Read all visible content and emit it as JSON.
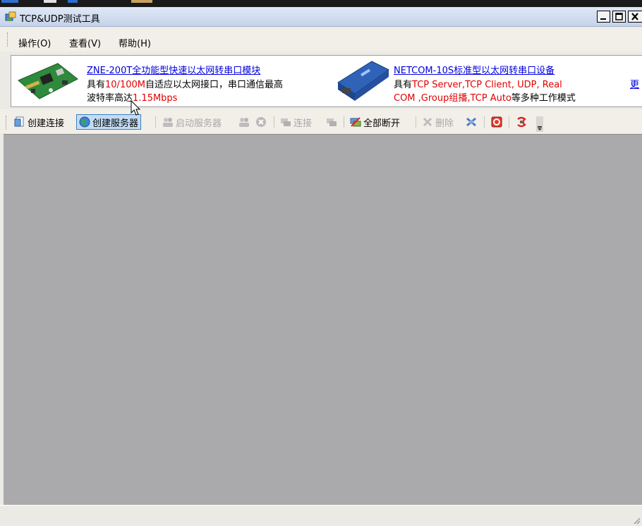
{
  "window": {
    "title": "TCP&UDP测试工具"
  },
  "menu": [
    {
      "label": "操作(O)"
    },
    {
      "label": "查看(V)"
    },
    {
      "label": "帮助(H)"
    }
  ],
  "ads": [
    {
      "title": "ZNE-200T全功能型快速以太网转串口模块",
      "line1": [
        {
          "t": "具有",
          "red": false
        },
        {
          "t": "10/100M",
          "red": true
        },
        {
          "t": "自适应以太网接口，串口通信最高",
          "red": false
        }
      ],
      "line2": [
        {
          "t": "波特率高达",
          "red": false
        },
        {
          "t": "1.15Mbps",
          "red": true
        }
      ]
    },
    {
      "title": "NETCOM-10S标准型以太网转串口设备",
      "line1": [
        {
          "t": "具有",
          "red": false
        },
        {
          "t": "TCP Server,TCP Client, UDP, Real",
          "red": true
        }
      ],
      "line2": [
        {
          "t": "COM ,Group组播,TCP Auto",
          "red": true
        },
        {
          "t": "等多种工作模式",
          "red": false
        }
      ]
    }
  ],
  "ad_more": "更",
  "toolbar": {
    "create_connection": "创建连接",
    "create_server": "创建服务器",
    "start_server": "启动服务器",
    "connect": "连接",
    "disconnect_all": "全部断开",
    "delete": "删除"
  },
  "colors": {
    "link": "#0000e0",
    "highlight": "#e00000",
    "workspace": "#aaa9ac"
  }
}
